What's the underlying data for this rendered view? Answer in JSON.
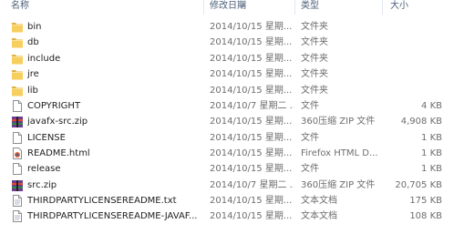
{
  "columns": {
    "name": "名称",
    "modified": "修改日期",
    "type": "类型",
    "size": "大小"
  },
  "files": [
    {
      "icon": "folder-icon",
      "name": "bin",
      "modified": "2014/10/15 星期...",
      "type": "文件夹",
      "size": ""
    },
    {
      "icon": "folder-icon",
      "name": "db",
      "modified": "2014/10/15 星期...",
      "type": "文件夹",
      "size": ""
    },
    {
      "icon": "folder-icon",
      "name": "include",
      "modified": "2014/10/15 星期...",
      "type": "文件夹",
      "size": ""
    },
    {
      "icon": "folder-icon",
      "name": "jre",
      "modified": "2014/10/15 星期...",
      "type": "文件夹",
      "size": ""
    },
    {
      "icon": "folder-icon",
      "name": "lib",
      "modified": "2014/10/15 星期...",
      "type": "文件夹",
      "size": ""
    },
    {
      "icon": "file-icon",
      "name": "COPYRIGHT",
      "modified": "2014/10/7 星期二 ...",
      "type": "文件",
      "size": "4 KB"
    },
    {
      "icon": "zip-archive-icon",
      "name": "javafx-src.zip",
      "modified": "2014/10/15 星期...",
      "type": "360压缩 ZIP 文件",
      "size": "4,908 KB"
    },
    {
      "icon": "file-icon",
      "name": "LICENSE",
      "modified": "2014/10/15 星期...",
      "type": "文件",
      "size": "1 KB"
    },
    {
      "icon": "html-file-icon",
      "name": "README.html",
      "modified": "2014/10/15 星期...",
      "type": "Firefox HTML D...",
      "size": "1 KB"
    },
    {
      "icon": "file-icon",
      "name": "release",
      "modified": "2014/10/15 星期...",
      "type": "文件",
      "size": "1 KB"
    },
    {
      "icon": "zip-archive-icon",
      "name": "src.zip",
      "modified": "2014/10/7 星期二 ...",
      "type": "360压缩 ZIP 文件",
      "size": "20,705 KB"
    },
    {
      "icon": "text-file-icon",
      "name": "THIRDPARTYLICENSEREADME.txt",
      "modified": "2014/10/15 星期...",
      "type": "文本文档",
      "size": "175 KB"
    },
    {
      "icon": "text-file-icon",
      "name": "THIRDPARTYLICENSEREADME-JAVAF...",
      "modified": "2014/10/15 星期...",
      "type": "文本文档",
      "size": "108 KB"
    }
  ]
}
